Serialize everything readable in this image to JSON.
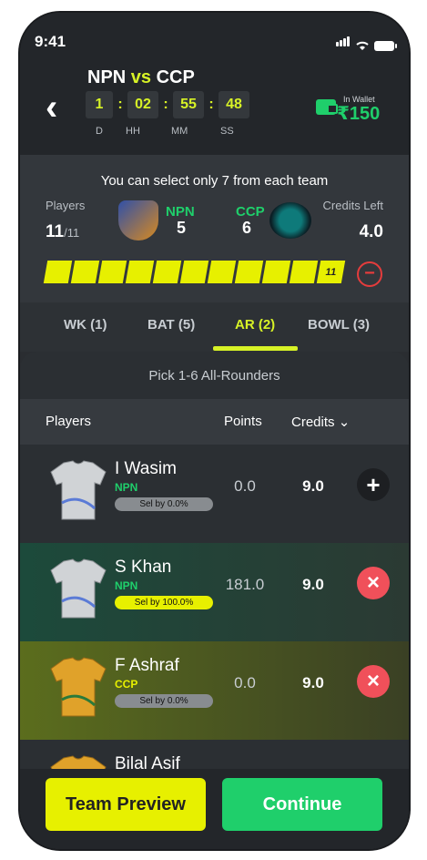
{
  "status": {
    "time": "9:41"
  },
  "header": {
    "team_a": "NPN",
    "vs": "vs",
    "team_b": "CCP",
    "timer": {
      "d": "1",
      "hh": "02",
      "mm": "55",
      "ss": "48"
    },
    "timer_labels": {
      "d": "D",
      "hh": "HH",
      "mm": "MM",
      "ss": "SS"
    },
    "wallet_label": "In Wallet",
    "wallet_amount": "₹150"
  },
  "selection": {
    "title": "You can select only 7 from each team",
    "players_label": "Players",
    "players_count": "11",
    "players_total": "/11",
    "team_a": "NPN",
    "team_a_count": "5",
    "team_b": "CCP",
    "team_b_count": "6",
    "credits_label": "Credits Left",
    "credits_value": "4.0",
    "progress_filled": 11,
    "progress_total": 11,
    "progress_label": "11"
  },
  "tabs": [
    {
      "label": "WK (1)"
    },
    {
      "label": "BAT (5)"
    },
    {
      "label": "AR (2)",
      "active": true
    },
    {
      "label": "BOWL (3)"
    }
  ],
  "panel": {
    "pick_text": "Pick 1-6 All-Rounders",
    "col_players": "Players",
    "col_points": "Points",
    "col_credits": "Credits",
    "rows": [
      {
        "name": "I Wasim",
        "team": "NPN",
        "selby": "Sel by 0.0%",
        "points": "0.0",
        "credits": "9.0",
        "action": "+"
      },
      {
        "name": "S Khan",
        "team": "NPN",
        "selby": "Sel by 100.0%",
        "points": "181.0",
        "credits": "9.0",
        "action": "×"
      },
      {
        "name": "F Ashraf",
        "team": "CCP",
        "selby": "Sel by 0.0%",
        "points": "0.0",
        "credits": "9.0",
        "action": "×"
      },
      {
        "name": "Bilal Asif"
      }
    ]
  },
  "footer": {
    "preview_label": "Team Preview",
    "continue_label": "Continue"
  },
  "colors": {
    "accent_yellow": "#e7f000",
    "accent_green": "#1fcf6b",
    "remove_red": "#f0505a"
  }
}
